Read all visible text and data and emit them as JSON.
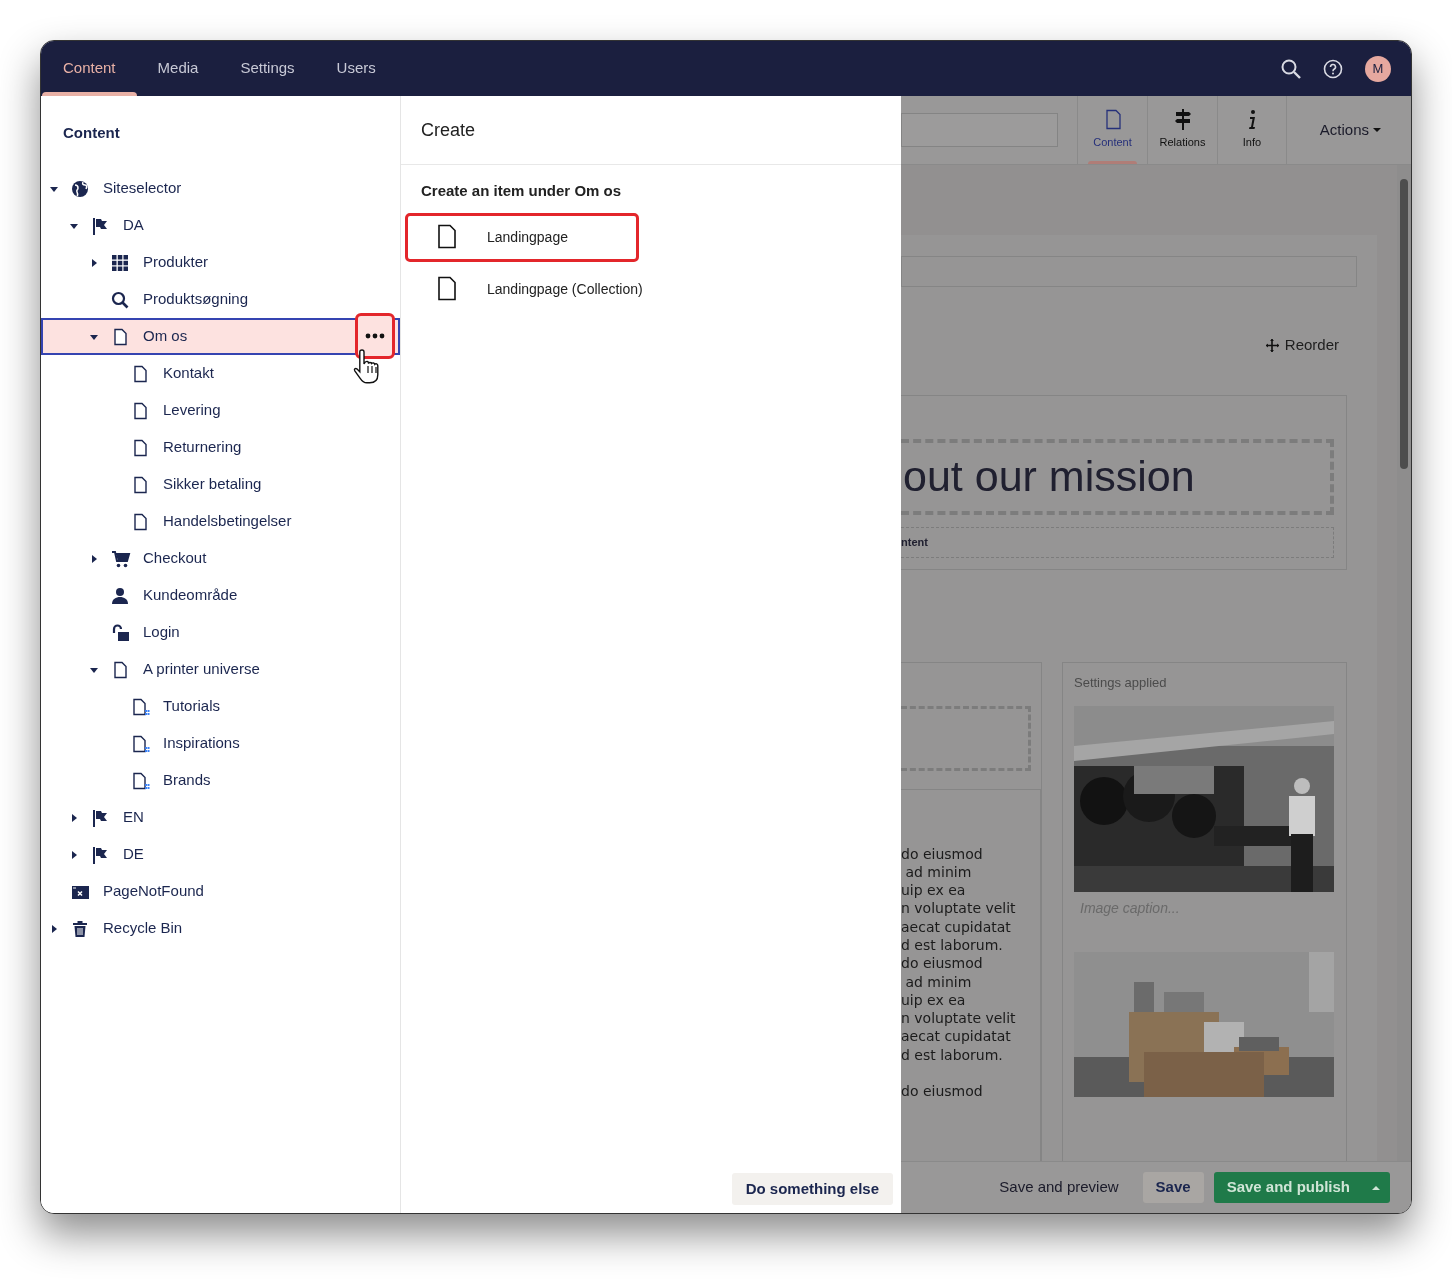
{
  "nav": {
    "sections": [
      {
        "label": "Content",
        "selected": true
      },
      {
        "label": "Media",
        "selected": false
      },
      {
        "label": "Settings",
        "selected": false
      },
      {
        "label": "Users",
        "selected": false
      }
    ],
    "avatar": "M"
  },
  "tree": {
    "title": "Content",
    "items": [
      {
        "label": "Siteselector",
        "kind": "globe",
        "expanded": true,
        "selected": false,
        "children": [
          {
            "label": "DA",
            "kind": "flag",
            "expanded": true,
            "selected": false,
            "children": [
              {
                "label": "Produkter",
                "kind": "grid",
                "expanded": false,
                "selected": false
              },
              {
                "label": "Produktsøgning",
                "kind": "search",
                "selected": false
              },
              {
                "label": "Om os",
                "kind": "document",
                "expanded": true,
                "selected": true,
                "children": [
                  {
                    "label": "Kontakt",
                    "kind": "document",
                    "selected": false
                  },
                  {
                    "label": "Levering",
                    "kind": "document",
                    "selected": false
                  },
                  {
                    "label": "Returnering",
                    "kind": "document",
                    "selected": false
                  },
                  {
                    "label": "Sikker betaling",
                    "kind": "document",
                    "selected": false
                  },
                  {
                    "label": "Handelsbetingelser",
                    "kind": "document",
                    "selected": false
                  }
                ]
              },
              {
                "label": "Checkout",
                "kind": "cart",
                "expanded": false,
                "selected": false
              },
              {
                "label": "Kundeområde",
                "kind": "user",
                "selected": false
              },
              {
                "label": "Login",
                "kind": "unlock",
                "selected": false
              },
              {
                "label": "A printer universe",
                "kind": "document",
                "expanded": true,
                "selected": false,
                "children": [
                  {
                    "label": "Tutorials",
                    "kind": "document-list",
                    "selected": false
                  },
                  {
                    "label": "Inspirations",
                    "kind": "document-list",
                    "selected": false
                  },
                  {
                    "label": "Brands",
                    "kind": "document-list",
                    "selected": false
                  }
                ]
              }
            ]
          },
          {
            "label": "EN",
            "kind": "flag",
            "expanded": false,
            "selected": false
          },
          {
            "label": "DE",
            "kind": "flag",
            "expanded": false,
            "selected": false
          }
        ]
      },
      {
        "label": "PageNotFound",
        "kind": "window-x",
        "selected": false
      },
      {
        "label": "Recycle Bin",
        "kind": "trash",
        "expanded": false,
        "selected": false
      }
    ]
  },
  "create": {
    "title": "Create",
    "subtitle": "Create an item under Om os",
    "options": [
      {
        "label": "Landingpage",
        "highlighted": true
      },
      {
        "label": "Landingpage (Collection)",
        "highlighted": false
      }
    ],
    "secondary_button": "Do something else"
  },
  "editor": {
    "tabs": [
      {
        "label": "Content",
        "kind": "document",
        "selected": true
      },
      {
        "label": "Relations",
        "kind": "signpost",
        "selected": false
      },
      {
        "label": "Info",
        "kind": "info",
        "selected": false
      }
    ],
    "actions": "Actions",
    "reorder": "Reorder",
    "heading": "out our mission",
    "content_label": "ntent",
    "text_paragraphs": [
      [
        "do eiusmod",
        " ad minim",
        "uip ex ea",
        "n voluptate velit",
        "aecat cupidatat",
        "d est laborum.",
        "do eiusmod",
        " ad minim",
        "uip ex ea",
        "n voluptate velit",
        "aecat cupidatat",
        "d est laborum."
      ],
      [
        "do eiusmod"
      ]
    ],
    "settings_label": "Settings applied",
    "image_caption": {
      "placeholder": "Image caption..."
    },
    "footer": {
      "preview": "Save and preview",
      "save": "Save",
      "publish": "Save and publish"
    }
  }
}
